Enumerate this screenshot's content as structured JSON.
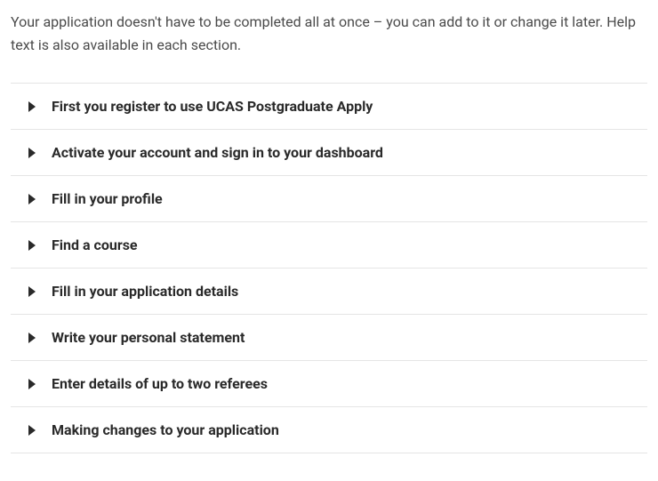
{
  "intro": "Your application doesn't have to be completed all at once – you can add to it or change it later. Help text is also available in each section.",
  "accordion": {
    "items": [
      {
        "label": "First you register to use UCAS Postgraduate Apply"
      },
      {
        "label": "Activate your account and sign in to your dashboard"
      },
      {
        "label": "Fill in your profile"
      },
      {
        "label": "Find a course"
      },
      {
        "label": "Fill in your application details"
      },
      {
        "label": "Write your personal statement"
      },
      {
        "label": "Enter details of up to two referees"
      },
      {
        "label": "Making changes to your application"
      }
    ]
  }
}
